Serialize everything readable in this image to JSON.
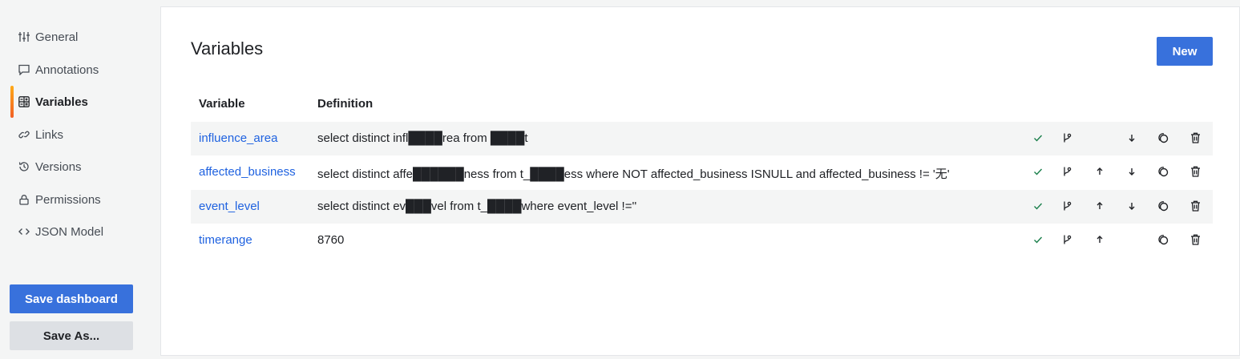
{
  "sidebar": {
    "items": [
      {
        "label": "General",
        "icon": "sliders-icon"
      },
      {
        "label": "Annotations",
        "icon": "comment-icon"
      },
      {
        "label": "Variables",
        "icon": "calculator-icon",
        "active": true
      },
      {
        "label": "Links",
        "icon": "link-icon"
      },
      {
        "label": "Versions",
        "icon": "history-icon"
      },
      {
        "label": "Permissions",
        "icon": "lock-icon"
      },
      {
        "label": "JSON Model",
        "icon": "code-icon"
      }
    ],
    "save_dashboard_label": "Save dashboard",
    "save_as_label": "Save As..."
  },
  "main": {
    "title": "Variables",
    "new_label": "New",
    "columns": {
      "variable": "Variable",
      "definition": "Definition"
    },
    "rows": [
      {
        "name": "influence_area",
        "definition": "select distinct infl████rea from ████t",
        "actions": [
          "check",
          "branch",
          "down",
          "duplicate",
          "delete"
        ]
      },
      {
        "name": "affected_business",
        "definition": "select distinct affe██████ness from t_████ess where NOT affected_business ISNULL and affected_business != '无'",
        "actions": [
          "check",
          "branch",
          "up",
          "down",
          "duplicate",
          "delete"
        ]
      },
      {
        "name": "event_level",
        "definition": "select distinct ev███vel from t_████where event_level !=''",
        "actions": [
          "check",
          "branch",
          "up",
          "down",
          "duplicate",
          "delete"
        ]
      },
      {
        "name": "timerange",
        "definition": "8760",
        "actions": [
          "check",
          "branch",
          "up",
          "duplicate",
          "delete"
        ]
      }
    ]
  },
  "colors": {
    "primary": "#3871dc",
    "link": "#1f62e0",
    "check": "#1a7f4b",
    "active_bar": "#f15f25"
  }
}
